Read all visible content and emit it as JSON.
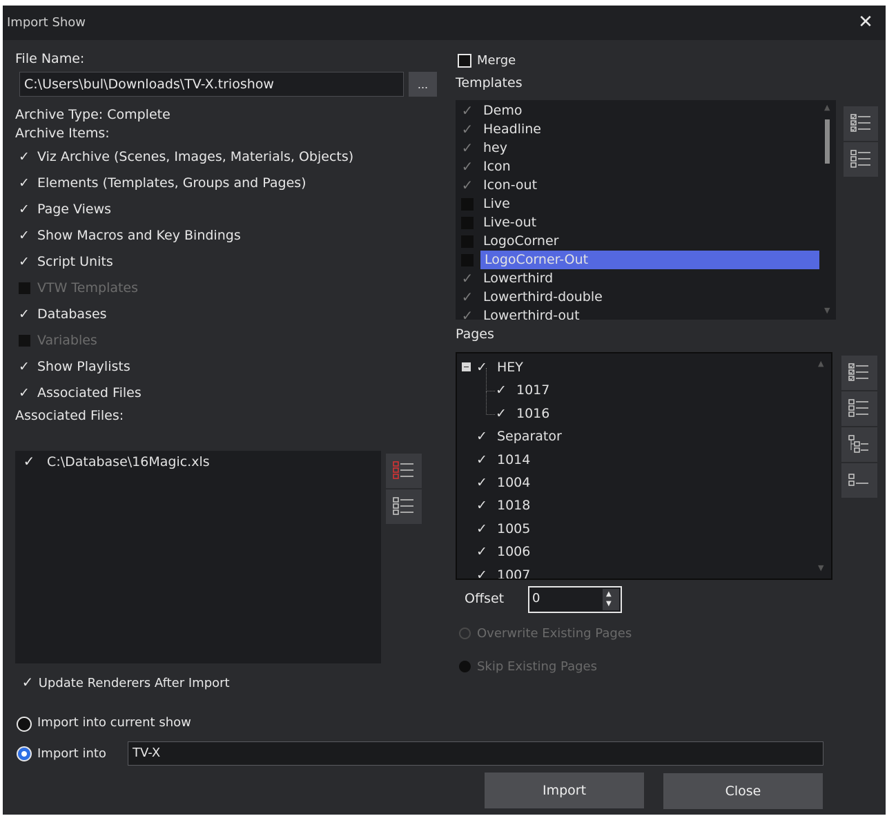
{
  "window": {
    "title": "Import Show",
    "close_glyph": "✕"
  },
  "file": {
    "label": "File Name:",
    "value": "C:\\Users\\bul\\Downloads\\TV-X.trioshow",
    "browse_label": "..."
  },
  "archive": {
    "type_label": "Archive Type: Complete",
    "items_label": "Archive Items:",
    "items": [
      {
        "label": "Viz Archive (Scenes, Images, Materials, Objects)",
        "checked": true
      },
      {
        "label": "Elements (Templates, Groups and Pages)",
        "checked": true
      },
      {
        "label": "Page Views",
        "checked": true
      },
      {
        "label": "Show Macros and Key Bindings",
        "checked": true
      },
      {
        "label": "Script Units",
        "checked": true
      },
      {
        "label": "VTW Templates",
        "checked": false
      },
      {
        "label": "Databases",
        "checked": true
      },
      {
        "label": "Variables",
        "checked": false
      },
      {
        "label": "Show Playlists",
        "checked": true
      },
      {
        "label": "Associated Files",
        "checked": true
      }
    ],
    "assoc_label": "Associated Files:",
    "assoc_files": [
      {
        "label": "C:\\Database\\16Magic.xls",
        "checked": true
      }
    ]
  },
  "update_renderers": {
    "label": "Update Renderers After Import",
    "checked": true
  },
  "import_target": {
    "current_label": "Import into current show",
    "into_label": "Import into",
    "into_value": "TV-X",
    "selected": "into"
  },
  "merge": {
    "label": "Merge",
    "checked": false
  },
  "templates": {
    "label": "Templates",
    "items": [
      {
        "label": "Demo",
        "checked": true
      },
      {
        "label": "Headline",
        "checked": true
      },
      {
        "label": "hey",
        "checked": true
      },
      {
        "label": "Icon",
        "checked": true
      },
      {
        "label": "Icon-out",
        "checked": true
      },
      {
        "label": "Live",
        "checked": false
      },
      {
        "label": "Live-out",
        "checked": false
      },
      {
        "label": "LogoCorner",
        "checked": false
      },
      {
        "label": "LogoCorner-Out",
        "checked": false,
        "selected": true
      },
      {
        "label": "Lowerthird",
        "checked": true
      },
      {
        "label": "Lowerthird-double",
        "checked": true
      },
      {
        "label": "Lowerthird-out",
        "checked": true
      }
    ]
  },
  "pages": {
    "label": "Pages",
    "items": [
      {
        "label": "HEY",
        "level": 0,
        "expander": "−"
      },
      {
        "label": "1017",
        "level": 1
      },
      {
        "label": "1016",
        "level": 1
      },
      {
        "label": "Separator",
        "level": 0
      },
      {
        "label": "1014",
        "level": 0
      },
      {
        "label": "1004",
        "level": 0
      },
      {
        "label": "1018",
        "level": 0
      },
      {
        "label": "1005",
        "level": 0
      },
      {
        "label": "1006",
        "level": 0
      },
      {
        "label": "1007",
        "level": 0
      }
    ]
  },
  "offset": {
    "label": "Offset",
    "value": "0"
  },
  "page_conflict": {
    "overwrite_label": "Overwrite Existing Pages",
    "skip_label": "Skip Existing Pages",
    "selected": "skip"
  },
  "buttons": {
    "import": "Import",
    "close": "Close"
  },
  "colors": {
    "selection": "#5468e0",
    "background": "#2a2b2e",
    "titlebar": "#1f2023"
  }
}
